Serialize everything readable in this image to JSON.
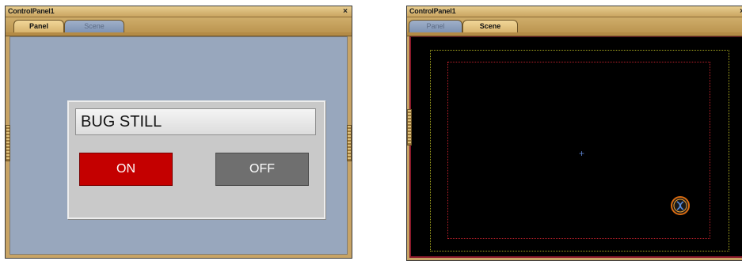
{
  "left_window": {
    "title": "ControlPanel1",
    "close_glyph": "×",
    "tabs": [
      {
        "label": "Panel",
        "active": true
      },
      {
        "label": "Scene",
        "active": false
      }
    ],
    "panel": {
      "label": "BUG STILL",
      "on_button": "ON",
      "off_button": "OFF"
    }
  },
  "right_window": {
    "title": "ControlPanel1",
    "close_glyph": "×",
    "tabs": [
      {
        "label": "Panel",
        "active": false
      },
      {
        "label": "Scene",
        "active": true
      }
    ],
    "scene": {
      "crosshair_glyph": "+",
      "icon": "scene-object-icon"
    }
  },
  "colors": {
    "frame": "#c8a465",
    "panel_bg": "#98a7bd",
    "on_button": "#c40000",
    "off_button": "#6f6f6f",
    "scene_bg": "#000000",
    "safe_outer": "#a8a81f",
    "safe_inner": "#b8202a"
  }
}
